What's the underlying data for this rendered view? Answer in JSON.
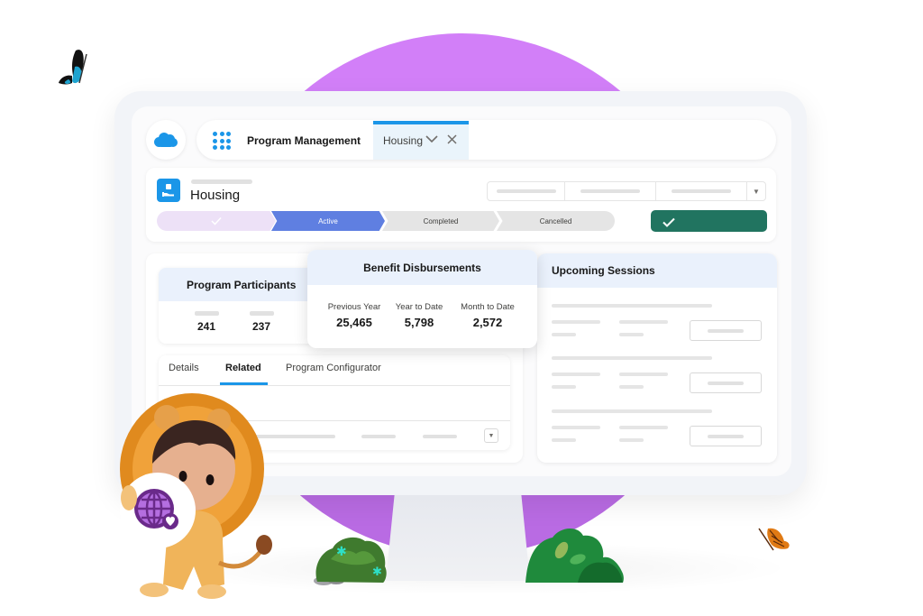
{
  "nav": {
    "app_name": "Program Management",
    "tabs": [
      {
        "label": "Housing",
        "active": true
      }
    ],
    "icons": {
      "logo": "salesforce-cloud-icon",
      "launcher": "app-launcher-icon",
      "tab_menu": "chevron-down-icon",
      "tab_close": "close-icon"
    }
  },
  "record": {
    "title": "Housing",
    "icon": "housing-hand-box-icon",
    "path": [
      {
        "label": "",
        "state": "complete",
        "icon": "check-icon"
      },
      {
        "label": "Active",
        "state": "current"
      },
      {
        "label": "Completed",
        "state": "incomplete"
      },
      {
        "label": "Cancelled",
        "state": "incomplete"
      }
    ],
    "mark_complete_icon": "check-icon",
    "action_menu_icon": "dropdown-triangle-icon"
  },
  "participants": {
    "title": "Program Participants",
    "values": [
      "241",
      "237"
    ]
  },
  "benefits": {
    "title": "Benefit Disbursements",
    "metrics": [
      {
        "label": "Previous Year",
        "value": "25,465"
      },
      {
        "label": "Year to Date",
        "value": "5,798"
      },
      {
        "label": "Month to Date",
        "value": "2,572"
      }
    ]
  },
  "record_tabs": {
    "items": [
      {
        "label": "Details",
        "active": false
      },
      {
        "label": "Related",
        "active": true
      },
      {
        "label": "Program Configurator",
        "active": false
      }
    ]
  },
  "sessions": {
    "title": "Upcoming Sessions",
    "row_count": 3
  },
  "colors": {
    "brand_blue": "#1b96e8",
    "path_active": "#5f7fe1",
    "path_complete": "#ede1f7",
    "mark_complete": "#217460",
    "background_circle": "#d27ff8",
    "card_header": "#eaf1fc"
  },
  "decorations": {
    "mascot": "lion-astro-mascot-holding-globe-heart-badge",
    "badge_icon": "globe-heart-icon",
    "butterflies": [
      "blue-butterfly",
      "orange-monarch-butterfly"
    ],
    "plants": [
      "bush-left",
      "bush-right"
    ]
  }
}
